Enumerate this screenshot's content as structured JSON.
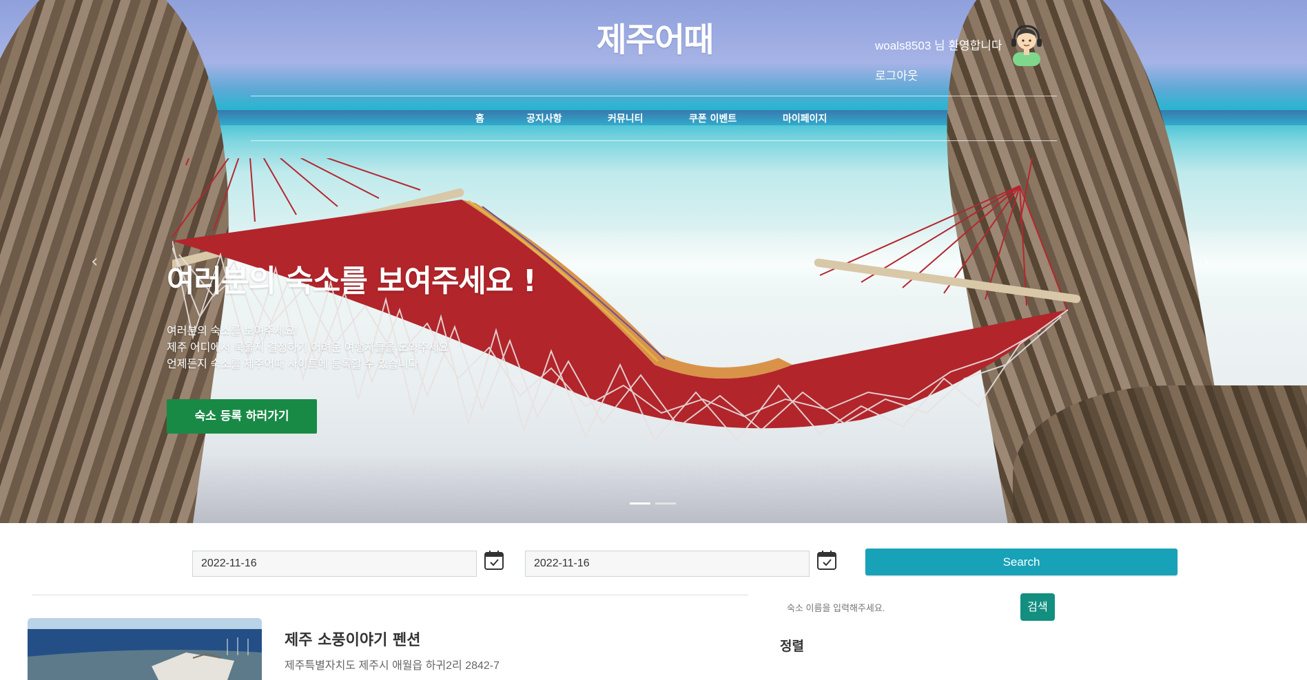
{
  "header": {
    "logo": "제주어때",
    "welcome": "woals8503 님 환영합니다",
    "logout": "로그아웃"
  },
  "nav": [
    {
      "label": "홈"
    },
    {
      "label": "공지사항"
    },
    {
      "label": "커뮤니티"
    },
    {
      "label": "쿠폰 이벤트"
    },
    {
      "label": "마이페이지"
    }
  ],
  "hero": {
    "title": "여러분의 숙소를 보여주세요 !",
    "desc_line1": "여러분의 숙소를 보여주세요!",
    "desc_line2": "제주 어디에서 묵을지 결정하기 어려운 여행자들을 도와주세요",
    "desc_line3": "언제든지 숙소를 제주어때 사이트에 등록할 수 있습니다",
    "cta_label": "숙소 등록 하러가기",
    "prev_arrow": "‹",
    "next_arrow": "›",
    "slides": 2,
    "active_slide": 1
  },
  "search": {
    "checkin": "2022-11-16",
    "checkout": "2022-11-16",
    "search_label": "Search",
    "name_placeholder": "숙소 이름을 입력해주세요.",
    "name_search_label": "검색",
    "sort_label": "정렬"
  },
  "listing": {
    "name": "제주 소풍이야기 펜션",
    "address": "제주특별자치도 제주시 애월읍 하귀2리 2842-7"
  },
  "colors": {
    "cta": "#198a45",
    "search_button": "#17a2b8",
    "name_search_button": "#138f7f"
  }
}
